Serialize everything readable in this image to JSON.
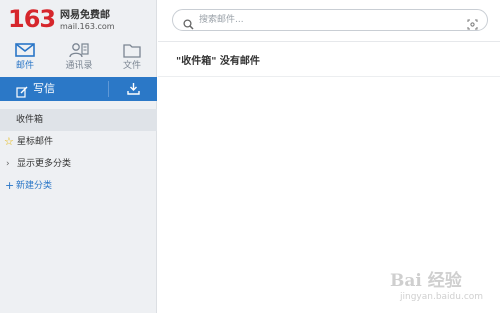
{
  "logo": {
    "number": "163",
    "name": "网易免费邮",
    "url": "mail.163.com"
  },
  "nav": {
    "tabs": [
      {
        "label": "邮件",
        "icon": "mail-icon",
        "active": true
      },
      {
        "label": "通讯录",
        "icon": "contacts-icon",
        "active": false
      },
      {
        "label": "文件",
        "icon": "folder-icon",
        "active": false
      }
    ]
  },
  "compose": {
    "write_label": "写信",
    "write_icon": "pencil-icon",
    "receive_icon": "download-icon"
  },
  "folders": {
    "inbox": "收件箱",
    "starred": "星标邮件",
    "more": "显示更多分类",
    "new": "新建分类"
  },
  "search": {
    "placeholder": "搜索邮件..."
  },
  "main": {
    "empty_message": "\"收件箱\" 没有邮件"
  },
  "watermark": {
    "text": "Bai 经验",
    "url": "jingyan.baidu.com"
  },
  "colors": {
    "brand_red": "#d6262c",
    "accent_blue": "#2b78c7",
    "sidebar_bg": "#eef0f3"
  }
}
